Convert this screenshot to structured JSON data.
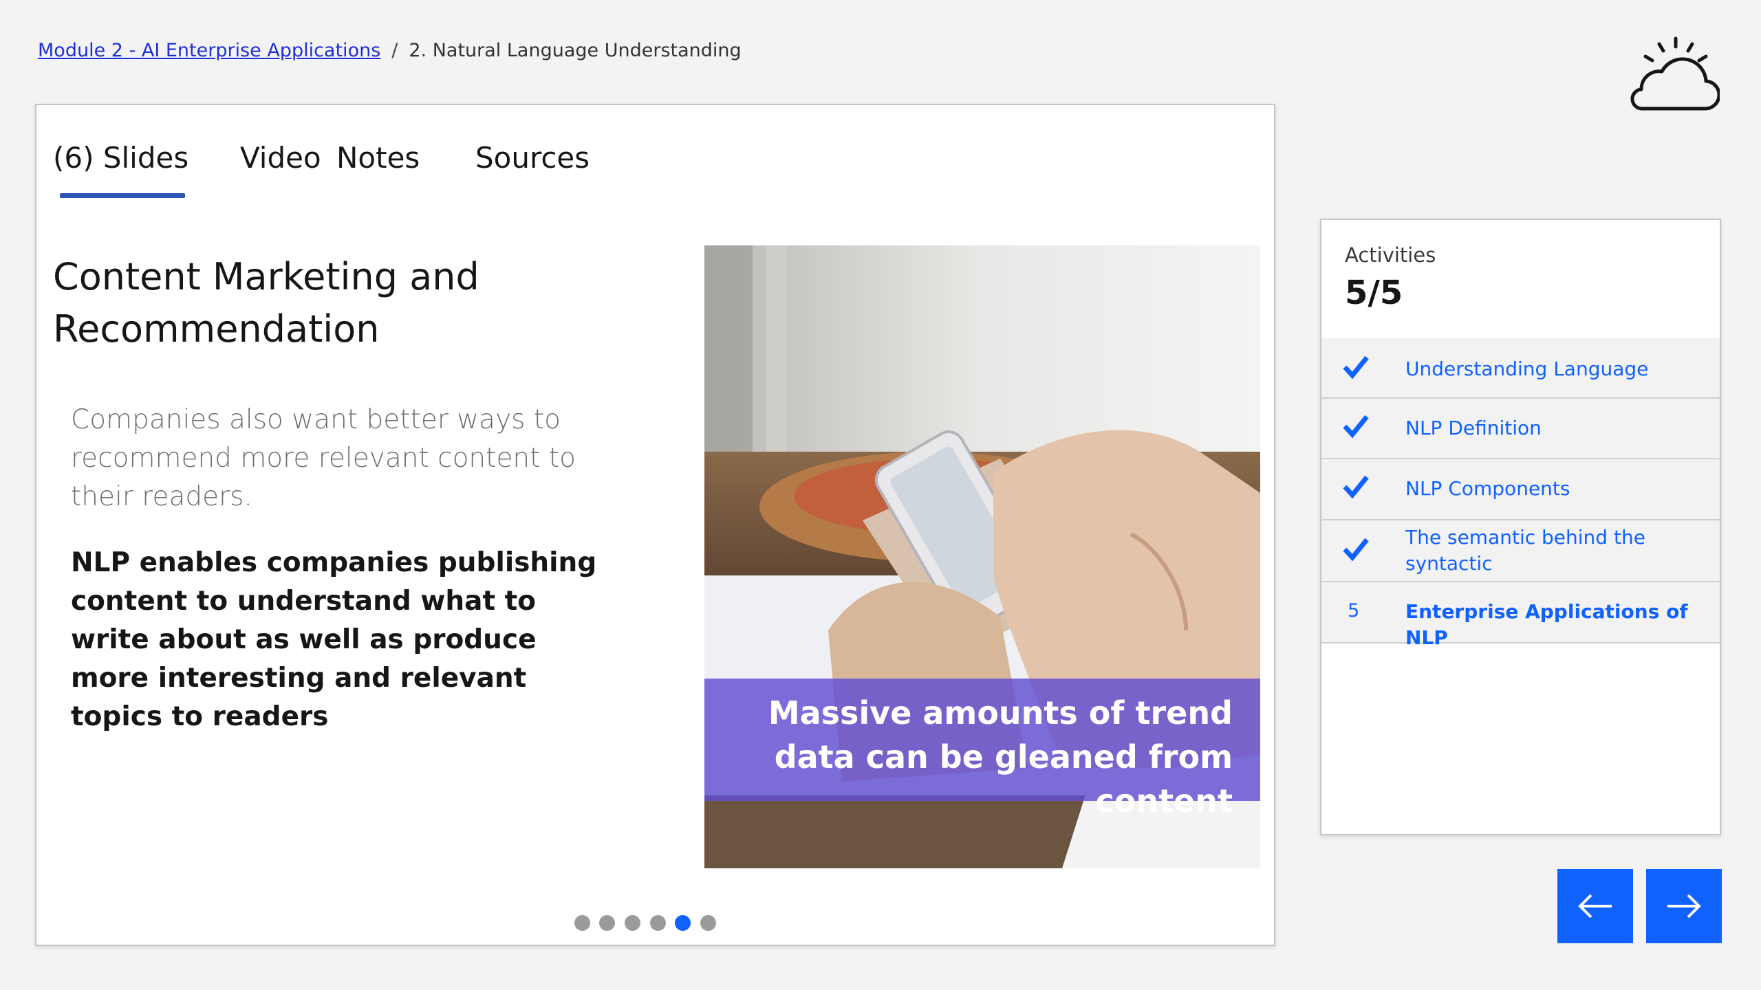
{
  "breadcrumb": {
    "module_link": "Module 2 - AI Enterprise Applications",
    "separator": "/",
    "current": "2. Natural Language Understanding"
  },
  "tabs": [
    {
      "label": "(6) Slides",
      "active": true
    },
    {
      "label": "Video",
      "active": false
    },
    {
      "label": "Notes",
      "active": false
    },
    {
      "label": "Sources",
      "active": false
    }
  ],
  "slide": {
    "title": "Content Marketing and Recommendation",
    "body": "Companies also want better ways  to recommend more relevant content to their readers.",
    "bold": "NLP enables companies publishing content to understand what to write about as well as produce  more interesting and relevant topics to readers",
    "image_caption": "Massive amounts of trend data can be gleaned from content"
  },
  "pagination": {
    "total": 6,
    "current": 5
  },
  "activities": {
    "label": "Activities",
    "count": "5/5",
    "items": [
      {
        "marker": "check-icon",
        "label": "Understanding Language"
      },
      {
        "marker": "check-icon",
        "label": "NLP Definition"
      },
      {
        "marker": "check-icon",
        "label": "NLP Components"
      },
      {
        "marker": "check-icon",
        "label": "The semantic behind the syntactic"
      },
      {
        "marker": "5",
        "label": "Enterprise Applications of NLP"
      }
    ]
  },
  "nav": {
    "prev_icon": "arrow-left-icon",
    "next_icon": "arrow-right-icon"
  },
  "colors": {
    "accent": "#0f62fe",
    "tab_underline": "#2a55b5",
    "overlay": "#624ed2",
    "link": "#1f2fd6"
  }
}
